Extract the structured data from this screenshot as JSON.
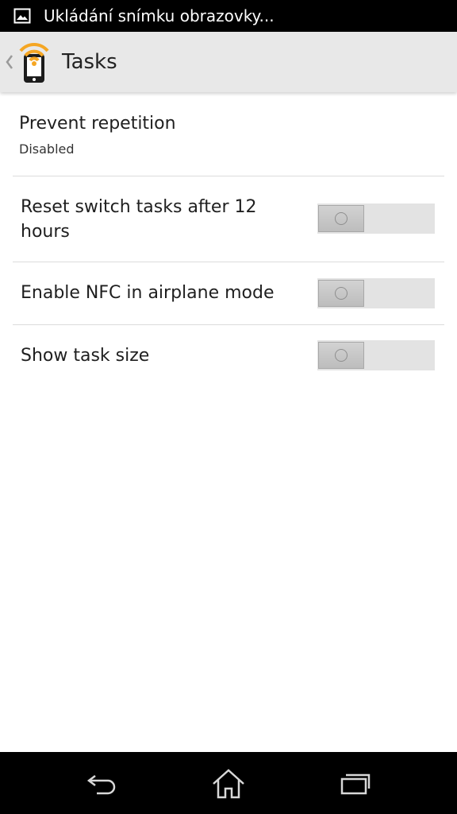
{
  "status_bar": {
    "notification_text": "Ukládání snímku obrazovky...",
    "notification_icon": "image-icon"
  },
  "action_bar": {
    "title": "Tasks",
    "app_icon": "nfc-phone-icon",
    "up_icon": "chevron-left-icon",
    "accent_color": "#f5a623"
  },
  "preferences": [
    {
      "title": "Prevent repetition",
      "summary": "Disabled"
    },
    {
      "title": "Reset switch tasks after 12 hours",
      "toggle": "off"
    },
    {
      "title": "Enable NFC in airplane mode",
      "toggle": "off"
    },
    {
      "title": "Show task size",
      "toggle": "off"
    }
  ],
  "nav_bar": {
    "back_icon": "back-icon",
    "home_icon": "home-icon",
    "recents_icon": "recents-icon"
  }
}
